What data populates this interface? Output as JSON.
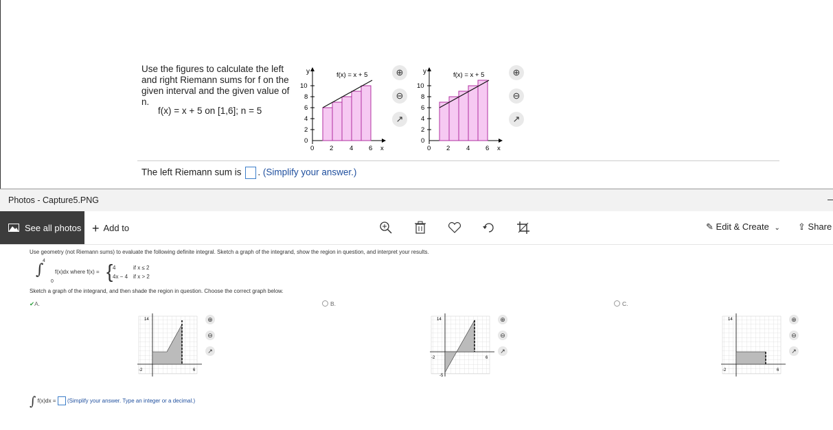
{
  "problem": {
    "text": "Use the figures to calculate the left and right Riemann sums for f on the given interval and the given value of n.",
    "function_line": "f(x) = x + 5 on [1,6]; n = 5",
    "answer_prefix": "The left Riemann sum is",
    "answer_hint": "(Simplify your answer.)",
    "graph_label": "f(x) = x + 5",
    "y_label": "y",
    "x_label": "x",
    "y_ticks": [
      "10",
      "8",
      "6",
      "4",
      "2",
      "0"
    ],
    "x_ticks": [
      "0",
      "2",
      "4",
      "6"
    ]
  },
  "photos": {
    "window_title": "Photos - Capture5.PNG",
    "see_all": "See all photos",
    "add_to": "Add to",
    "edit_create": "Edit & Create",
    "share": "Share",
    "icons": [
      "zoom-in-icon",
      "delete-icon",
      "heart-icon",
      "rotate-icon",
      "crop-icon"
    ]
  },
  "inner": {
    "question": "Use geometry (not Riemann sums) to evaluate the following definite integral. Sketch a graph of the integrand, show the region in question, and interpret your results.",
    "integral_text": "f(x)dx where f(x) =",
    "upper": "4",
    "lower": "0",
    "case1": "4",
    "case1_cond": "if x ≤ 2",
    "case2": "4x − 4",
    "case2_cond": "if x > 2",
    "sketch_prompt": "Sketch a graph of the integrand, and then shade the region in question. Choose the correct graph below.",
    "options": [
      "A.",
      "B.",
      "C."
    ],
    "answer_integral": "f(x)dx =",
    "answer_hint": "(Simplify your answer. Type an integer or a decimal.)",
    "graph_y_top": "14",
    "graph_x_left": "-2",
    "graph_x_right": "6",
    "graph_y_low_b": "-5"
  }
}
